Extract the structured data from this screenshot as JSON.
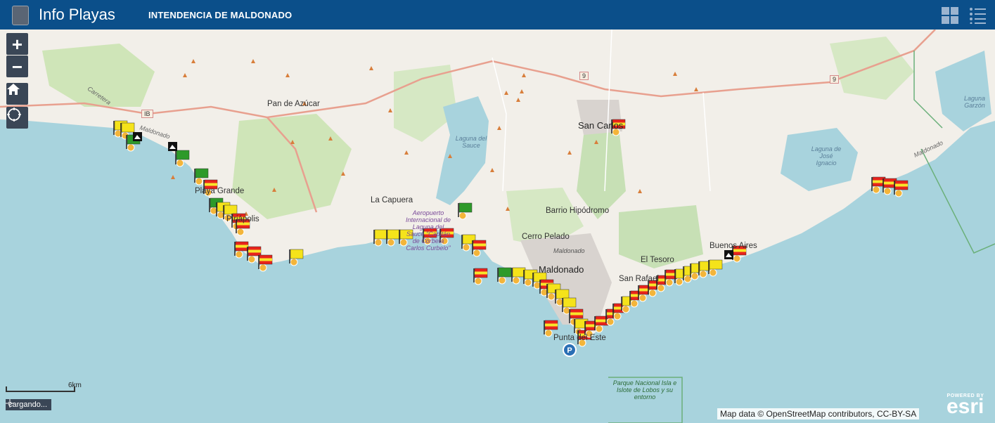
{
  "header": {
    "app_title": "Info Playas",
    "org_title": "INTENDENCIA DE MALDONADO",
    "colors": {
      "bar": "#0b4f8a",
      "text": "#ffffff"
    }
  },
  "controls": {
    "zoom_in": "+",
    "zoom_out": "−",
    "home_icon": "home-icon",
    "locate_icon": "locate-icon"
  },
  "map_labels": {
    "pan_de_azucar": "Pan de Azúcar",
    "san_carlos": "San Carlos",
    "playa_grande": "Playa Grande",
    "piriapolis": "Piriápolis",
    "la_capuera": "La Capuera",
    "barrio_hipodromo": "Barrio Hipódromo",
    "cerro_pelado": "Cerro Pelado",
    "maldonado_small": "Maldonado",
    "maldonado": "Maldonado",
    "el_tesoro": "El Tesoro",
    "san_rafael": "San Rafael",
    "buenos_aires": "Buenos Aires",
    "punta_del_este": "Punta del Este",
    "laguna_del_sauce": "Laguna del Sauce",
    "laguna_jose_ignacio": "Laguna de José Ignacio",
    "laguna_garzon": "Laguna Garzón",
    "airport": "Aeropuerto Internacional de Laguna del Sauce \"Capitán de Corbeta Carlos Curbelo\"",
    "park": "Parque Nacional Isla e Islote de Lobos y su entorno",
    "road_carretera": "Carretera",
    "road_maldonado_w": "Maldonado",
    "road_maldonado_e": "Maldonado"
  },
  "route_badges": {
    "ib": "IB",
    "r9a": "9",
    "r9b": "9"
  },
  "beach_flags": {
    "colors": {
      "yellow": "#f5e31a",
      "green": "#2e9a2a",
      "red_yellow_red": "#e8231c",
      "yellow_band": "#f7e62a"
    },
    "legend": [
      "yellow",
      "green",
      "red-yellow"
    ]
  },
  "scale": {
    "label": "6km"
  },
  "status": {
    "text": "cargando..."
  },
  "attribution": "Map data © OpenStreetMap contributors, CC-BY-SA",
  "esri": {
    "powered": "POWERED BY",
    "name": "esri"
  }
}
